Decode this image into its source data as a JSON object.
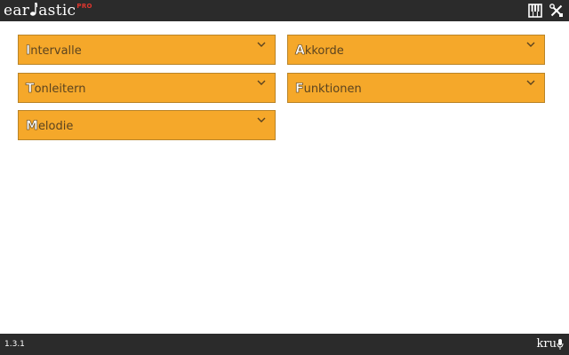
{
  "app": {
    "logo_left": "ear",
    "logo_right": "astic",
    "logo_badge": "PRO"
  },
  "toolbar": {
    "icons": [
      "piano-keys-icon",
      "tools-icon"
    ]
  },
  "menu": {
    "items": [
      {
        "first": "I",
        "rest": "ntervalle"
      },
      {
        "first": "A",
        "rest": "kkorde"
      },
      {
        "first": "T",
        "rest": "onleitern"
      },
      {
        "first": "F",
        "rest": "unktionen"
      },
      {
        "first": "M",
        "rest": "elodie"
      }
    ]
  },
  "footer": {
    "version": "1.3.1",
    "brand": "kru"
  },
  "colors": {
    "bar": "#2b2b2b",
    "card": "#f5a82a",
    "card_border": "#b98428",
    "accent_red": "#e0362e"
  }
}
